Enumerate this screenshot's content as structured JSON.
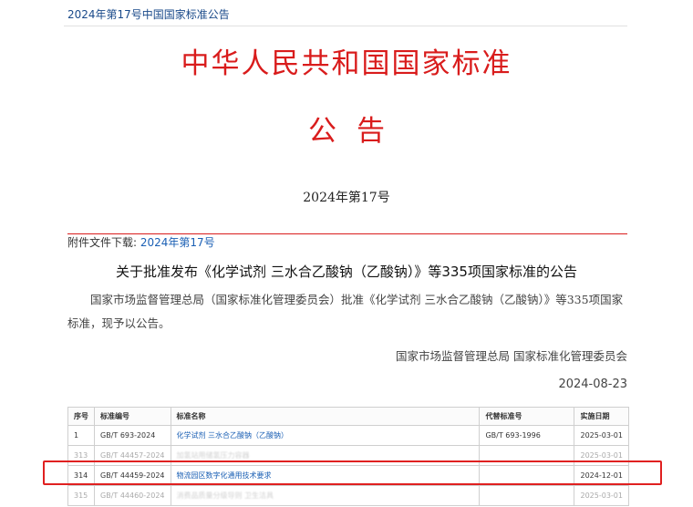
{
  "breadcrumb": "2024年第17号中国国家标准公告",
  "header": {
    "main_title": "中华人民共和国国家标准",
    "sub_title": "公告",
    "issue_no": "2024年第17号"
  },
  "attachment": {
    "label": "附件文件下载:",
    "link": "2024年第17号"
  },
  "notice": {
    "title": "关于批准发布《化学试剂 三水合乙酸钠（乙酸钠）》等335项国家标准的公告",
    "body": "国家市场监督管理总局（国家标准化管理委员会）批准《化学试剂 三水合乙酸钠（乙酸钠）》等335项国家标准，现予以公告。",
    "signer": "国家市场监督管理总局 国家标准化管理委员会",
    "date": "2024-08-23"
  },
  "table": {
    "headers": [
      "序号",
      "标准编号",
      "标准名称",
      "代替标准号",
      "实施日期"
    ],
    "rows": [
      {
        "no": "1",
        "code": "GB/T 693-2024",
        "name": "化学试剂 三水合乙酸钠（乙酸钠）",
        "replace": "GB/T 693-1996",
        "date": "2025-03-01"
      },
      {
        "no": "313",
        "code": "GB/T 44457-2024",
        "name": "加氢站用储氢压力容器",
        "replace": "",
        "date": "2025-03-01"
      },
      {
        "no": "314",
        "code": "GB/T 44459-2024",
        "name": "物流园区数字化通用技术要求",
        "replace": "",
        "date": "2024-12-01"
      },
      {
        "no": "315",
        "code": "GB/T 44460-2024",
        "name": "消费品质量分级导则 卫生洁具",
        "replace": "",
        "date": "2025-03-01"
      }
    ]
  },
  "colors": {
    "accent_red": "#d91c1c",
    "link_blue": "#1a5fb4",
    "highlight_box": "#e02020"
  }
}
